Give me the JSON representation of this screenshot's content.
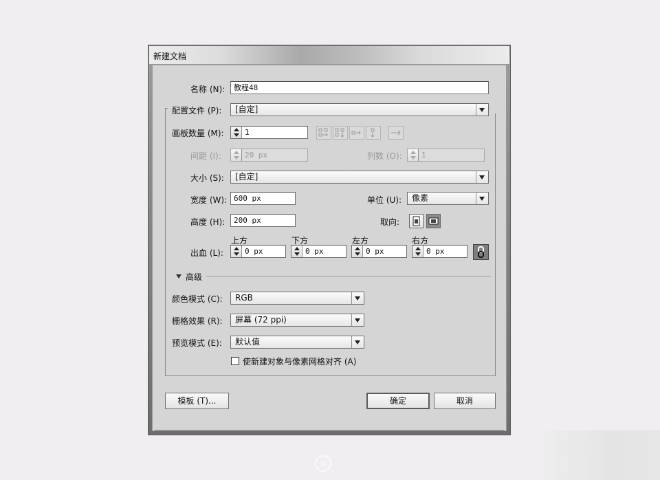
{
  "dialog": {
    "title": "新建文档"
  },
  "name": {
    "label": "名称 (N):",
    "value": "教程48"
  },
  "profile": {
    "label": "配置文件 (P):",
    "value": "[自定]"
  },
  "artboards": {
    "label": "画板数量 (M):",
    "value": "1"
  },
  "spacing": {
    "label": "间距 (I):",
    "value": "20 px"
  },
  "columns": {
    "label": "列数 (O):",
    "value": "1"
  },
  "size": {
    "label": "大小 (S):",
    "value": "[自定]"
  },
  "width": {
    "label": "宽度 (W):",
    "value": "600 px"
  },
  "units": {
    "label": "单位 (U):",
    "value": "像素"
  },
  "height": {
    "label": "高度 (H):",
    "value": "200 px"
  },
  "orientation": {
    "label": "取向:"
  },
  "bleed": {
    "label": "出血 (L):",
    "top_label": "上方",
    "top": "0 px",
    "bottom_label": "下方",
    "bottom": "0 px",
    "left_label": "左方",
    "left": "0 px",
    "right_label": "右方",
    "right": "0 px"
  },
  "advanced": {
    "label": "高级",
    "color_mode": {
      "label": "颜色模式 (C):",
      "value": "RGB"
    },
    "raster": {
      "label": "栅格效果 (R):",
      "value": "屏幕 (72 ppi)"
    },
    "preview": {
      "label": "预览模式 (E):",
      "value": "默认值"
    },
    "align_pixel": {
      "label": "使新建对象与像素网格对齐 (A)",
      "checked": false
    }
  },
  "buttons": {
    "templates": "模板 (T)...",
    "ok": "确定",
    "cancel": "取消"
  },
  "icons": [
    "grid-by-row-icon",
    "grid-by-column-icon",
    "arrange-by-row-icon",
    "arrange-by-column-icon",
    "right-to-left-icon",
    "portrait-icon",
    "landscape-icon",
    "link-icon",
    "disclosure-triangle-icon"
  ]
}
